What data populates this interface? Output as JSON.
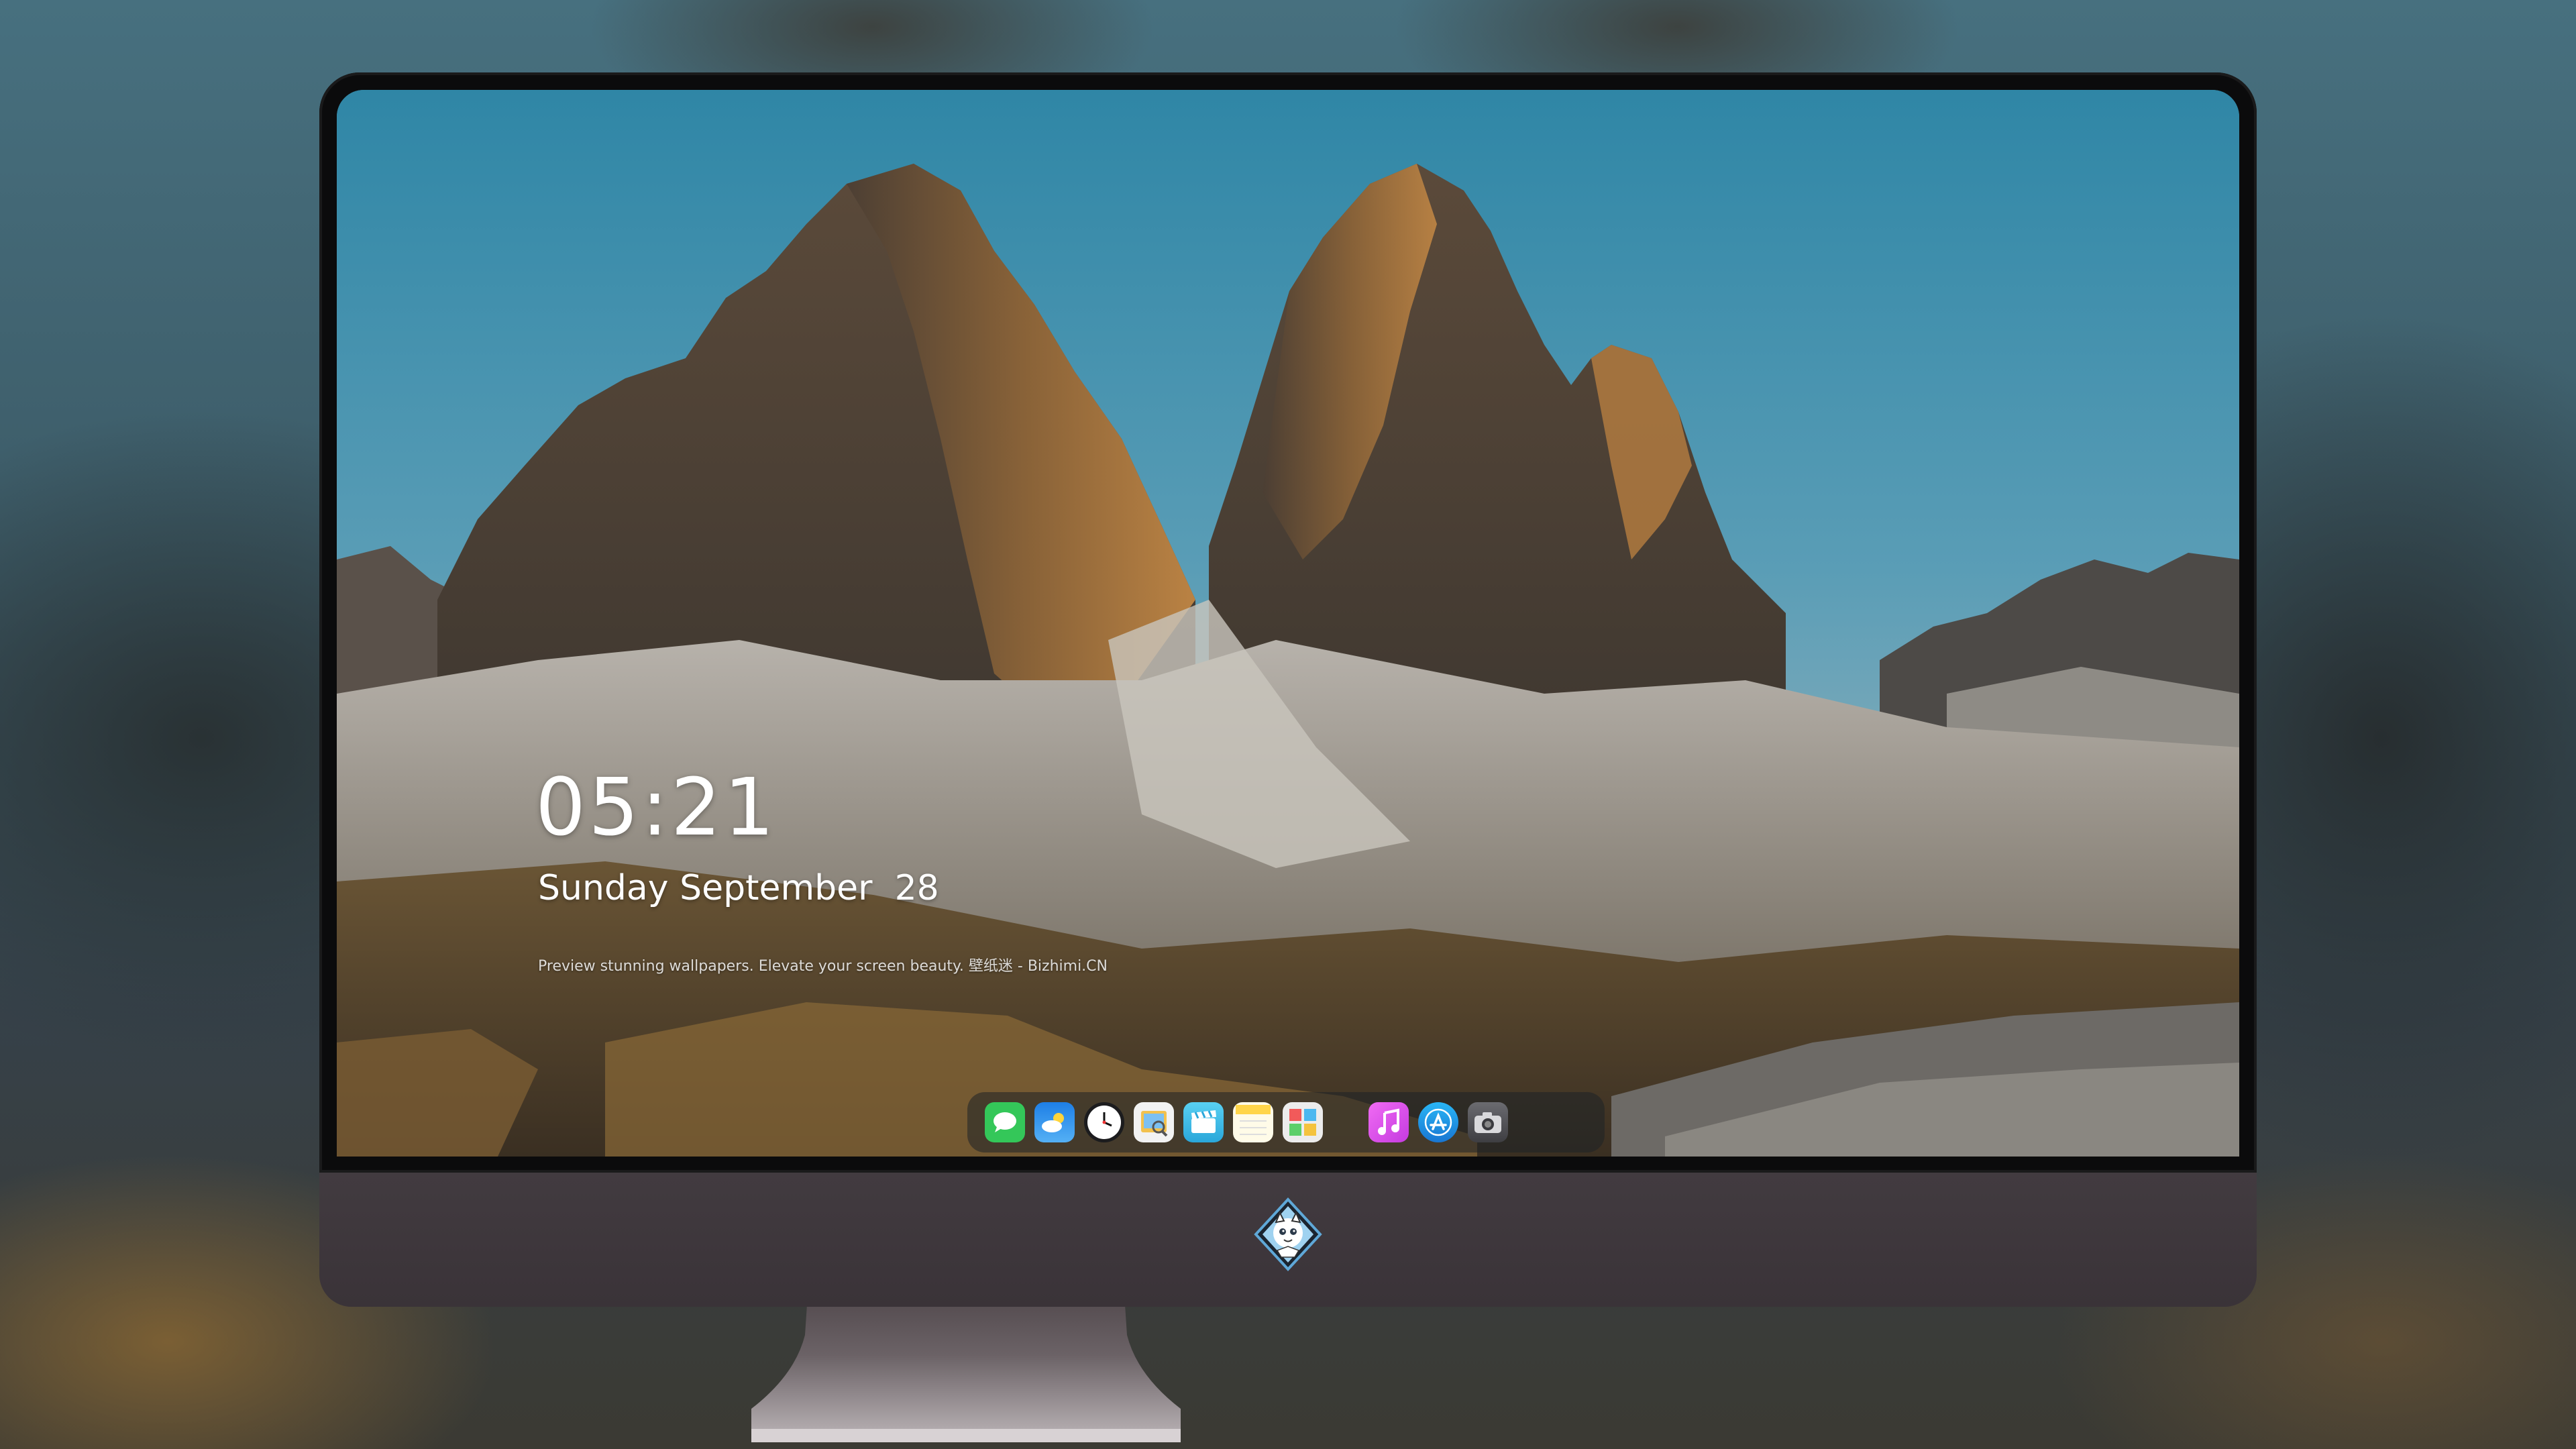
{
  "lock_screen": {
    "time": "05:21",
    "date": "Sunday September  28",
    "tagline": "Preview stunning wallpapers. Elevate your screen beauty. 壁纸迷 - Bizhimi.CN"
  },
  "dock": {
    "apps": [
      {
        "name": "Messages",
        "icon": "messages-icon",
        "color": "#34c759"
      },
      {
        "name": "Weather",
        "icon": "weather-icon",
        "color": "#2e8ff0"
      },
      {
        "name": "Clock",
        "icon": "clock-icon",
        "color": "#ffffff"
      },
      {
        "name": "Preview",
        "icon": "preview-icon",
        "color": "#f2c14e"
      },
      {
        "name": "Clips",
        "icon": "clips-icon",
        "color": "#4fc6e8"
      },
      {
        "name": "Notes",
        "icon": "notes-icon",
        "color": "#ffd54a"
      },
      {
        "name": "Photo Booth",
        "icon": "photo-app-icon",
        "color": "#e8e8e8"
      },
      {
        "name": "Music",
        "icon": "music-icon",
        "color": "#e94cf0"
      },
      {
        "name": "App Store",
        "icon": "app-store-icon",
        "color": "#1f9bf0"
      },
      {
        "name": "Camera",
        "icon": "camera-icon",
        "color": "#4a4a4e"
      }
    ]
  },
  "brand": {
    "logo": "bizhimi-mascot-logo"
  },
  "colors": {
    "monitor_chin": "#3d363b",
    "bezel": "#0b0b0c",
    "sky": "#3b8aa8"
  }
}
